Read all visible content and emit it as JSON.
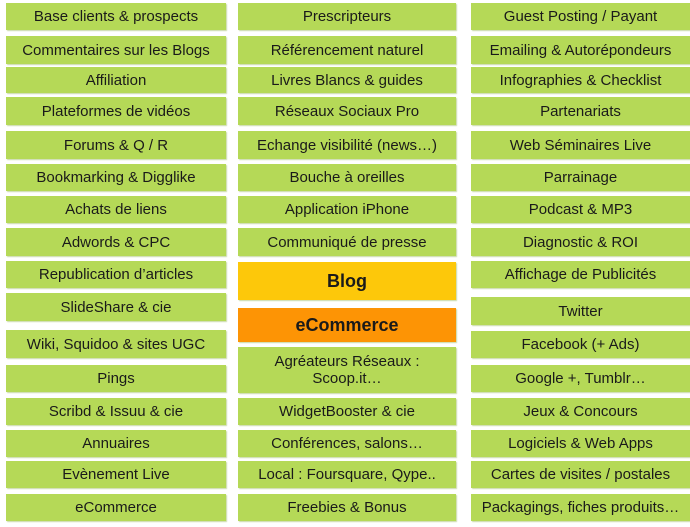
{
  "colors": {
    "tile": "#b5d957",
    "blog": "#fdc80a",
    "ecommerce": "#fd9405"
  },
  "left": [
    "Base clients & prospects",
    "Commentaires sur les Blogs",
    "Affiliation",
    "Plateformes de vidéos",
    "Forums & Q / R",
    "Bookmarking & Digglike",
    "Achats de liens",
    "Adwords & CPC",
    "Republication d’articles",
    "SlideShare & cie",
    "Wiki, Squidoo & sites UGC",
    "Pings",
    "Scribd & Issuu & cie",
    "Annuaires",
    "Evènement Live",
    "eCommerce"
  ],
  "middle": [
    "Prescripteurs",
    "Référencement naturel",
    "Livres Blancs & guides",
    "Réseaux Sociaux Pro",
    "Echange visibilité (news…)",
    "Bouche à oreilles",
    "Application iPhone",
    "Communiqué de presse",
    "Blog",
    "eCommerce",
    "Agréateurs Réseaux : Scoop.it…",
    "WidgetBooster & cie",
    "Conférences, salons…",
    "Local : Foursquare, Qype..",
    "Freebies & Bonus"
  ],
  "right": [
    "Guest Posting / Payant",
    "Emailing & Autorépondeurs",
    "Infographies & Checklist",
    "Partenariats",
    "Web Séminaires Live",
    "Parrainage",
    "Podcast & MP3",
    "Diagnostic & ROI",
    "Affichage de Publicités",
    "Twitter",
    "Facebook (+ Ads)",
    "Google +, Tumblr…",
    "Jeux & Concours",
    "Logiciels & Web Apps",
    "Cartes de visites / postales",
    "Packagings, fiches produits…"
  ]
}
